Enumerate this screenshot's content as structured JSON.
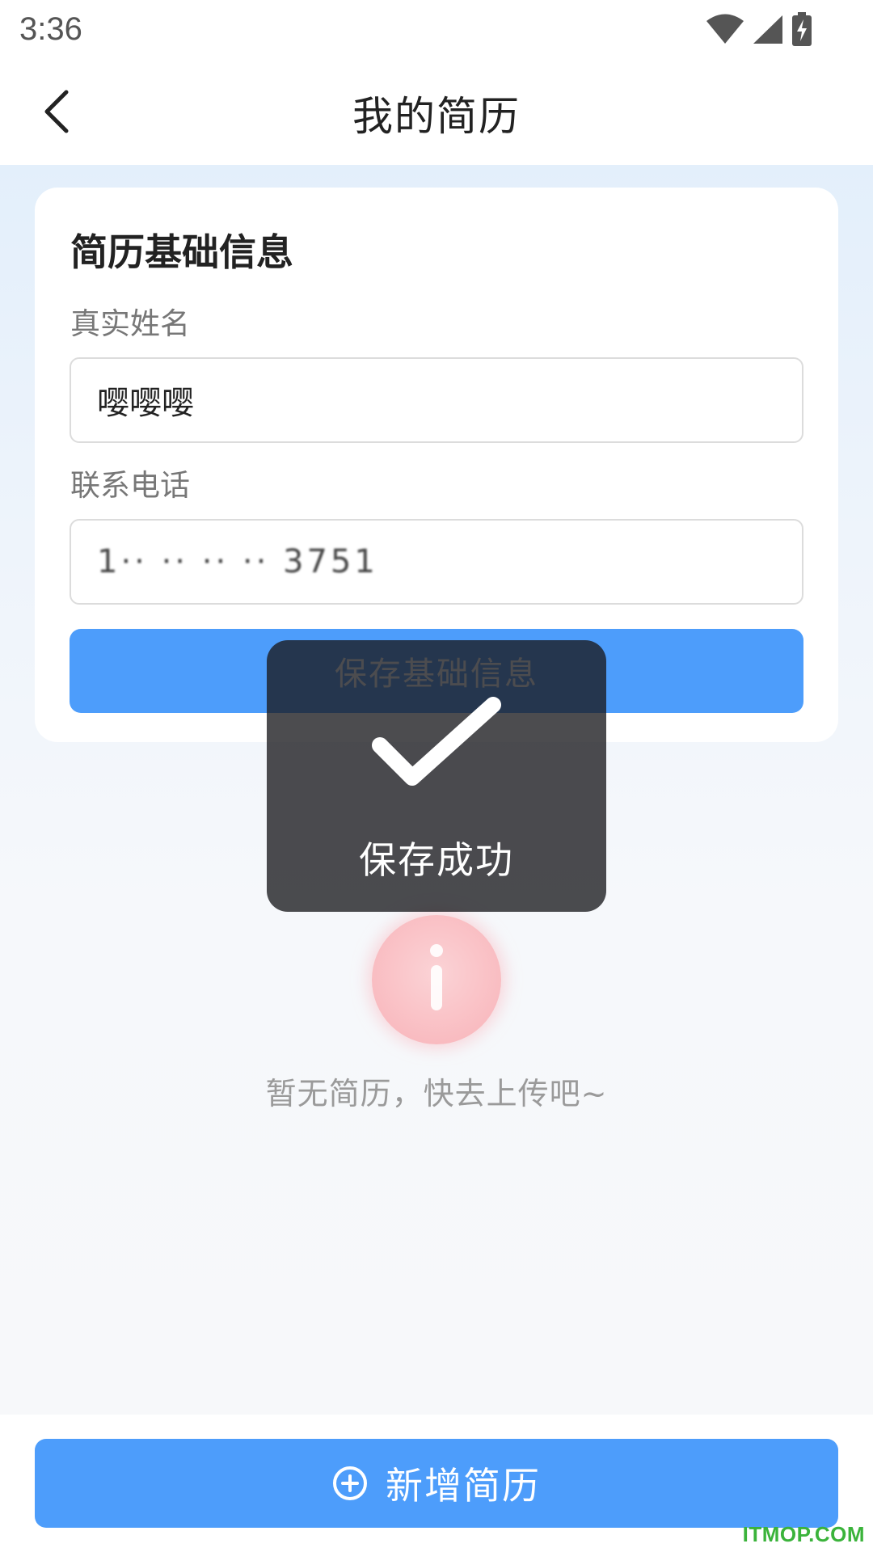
{
  "status_bar": {
    "time": "3:36",
    "icons": [
      "wifi-icon",
      "cellular-signal-icon",
      "battery-charging-icon"
    ]
  },
  "nav": {
    "title": "我的简历",
    "back_icon": "chevron-left-icon"
  },
  "card": {
    "title": "简历基础信息",
    "name_label": "真实姓名",
    "name_value": "嘤嘤嘤",
    "phone_label": "联系电话",
    "phone_value": "1·· ·· ·· ·· 3751",
    "save_button": "保存基础信息"
  },
  "empty_state": {
    "icon": "info-icon",
    "text": "暂无简历，快去上传吧~"
  },
  "bottom": {
    "add_button": "新增简历",
    "add_icon": "plus-circle-icon"
  },
  "toast": {
    "icon": "checkmark-icon",
    "text": "保存成功"
  },
  "watermark": "ITMOP.COM",
  "colors": {
    "primary": "#4d9dfb",
    "toast_bg": "rgba(25,25,30,0.78)",
    "empty_icon": "#f9bcc1"
  }
}
